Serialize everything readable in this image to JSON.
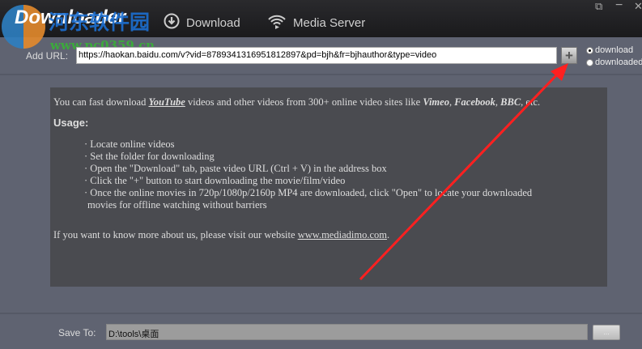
{
  "header": {
    "app_title": "Downloader",
    "watermark": "河东软件园",
    "watermark_url": "www.pc0359.cn",
    "tabs": [
      {
        "label": "Download",
        "icon": "download-circle-icon"
      },
      {
        "label": "Media Server",
        "icon": "wifi-icon"
      }
    ]
  },
  "toolbar": {
    "add_url_label": "Add URL:",
    "url_value": "https://haokan.baidu.com/v?vid=8789341316951812897&pd=bjh&fr=bjhauthor&type=video",
    "add_button": "+",
    "radios": [
      {
        "label": "download",
        "checked": true
      },
      {
        "label": "downloaded",
        "checked": false
      }
    ]
  },
  "content": {
    "intro_parts": [
      "You can fast download ",
      "YouTube",
      " videos and other videos from 300+ online video sites like ",
      "Vimeo",
      ", ",
      "Facebook",
      ", ",
      "BBC",
      ", etc."
    ],
    "usage_title": "Usage:",
    "steps": [
      "Locate online videos",
      "Set the folder for downloading",
      "Open the \"Download\" tab, paste video URL (Ctrl + V) in the address box",
      "Click the \"+\" button to start downloading the movie/film/video",
      "Once the online movies in 720p/1080p/2160p MP4 are downloaded, click \"Open\" to locate your downloaded",
      "movies for offline watching without barriers"
    ],
    "footer_text": "If you want to know more about us, please visit our website ",
    "footer_link": "www.mediadimo.com",
    "footer_end": "."
  },
  "bottom": {
    "save_to_label": "Save To:",
    "save_path": "D:\\tools\\桌面",
    "browse_button": "..."
  },
  "colors": {
    "annotation_arrow": "#ff2020"
  }
}
